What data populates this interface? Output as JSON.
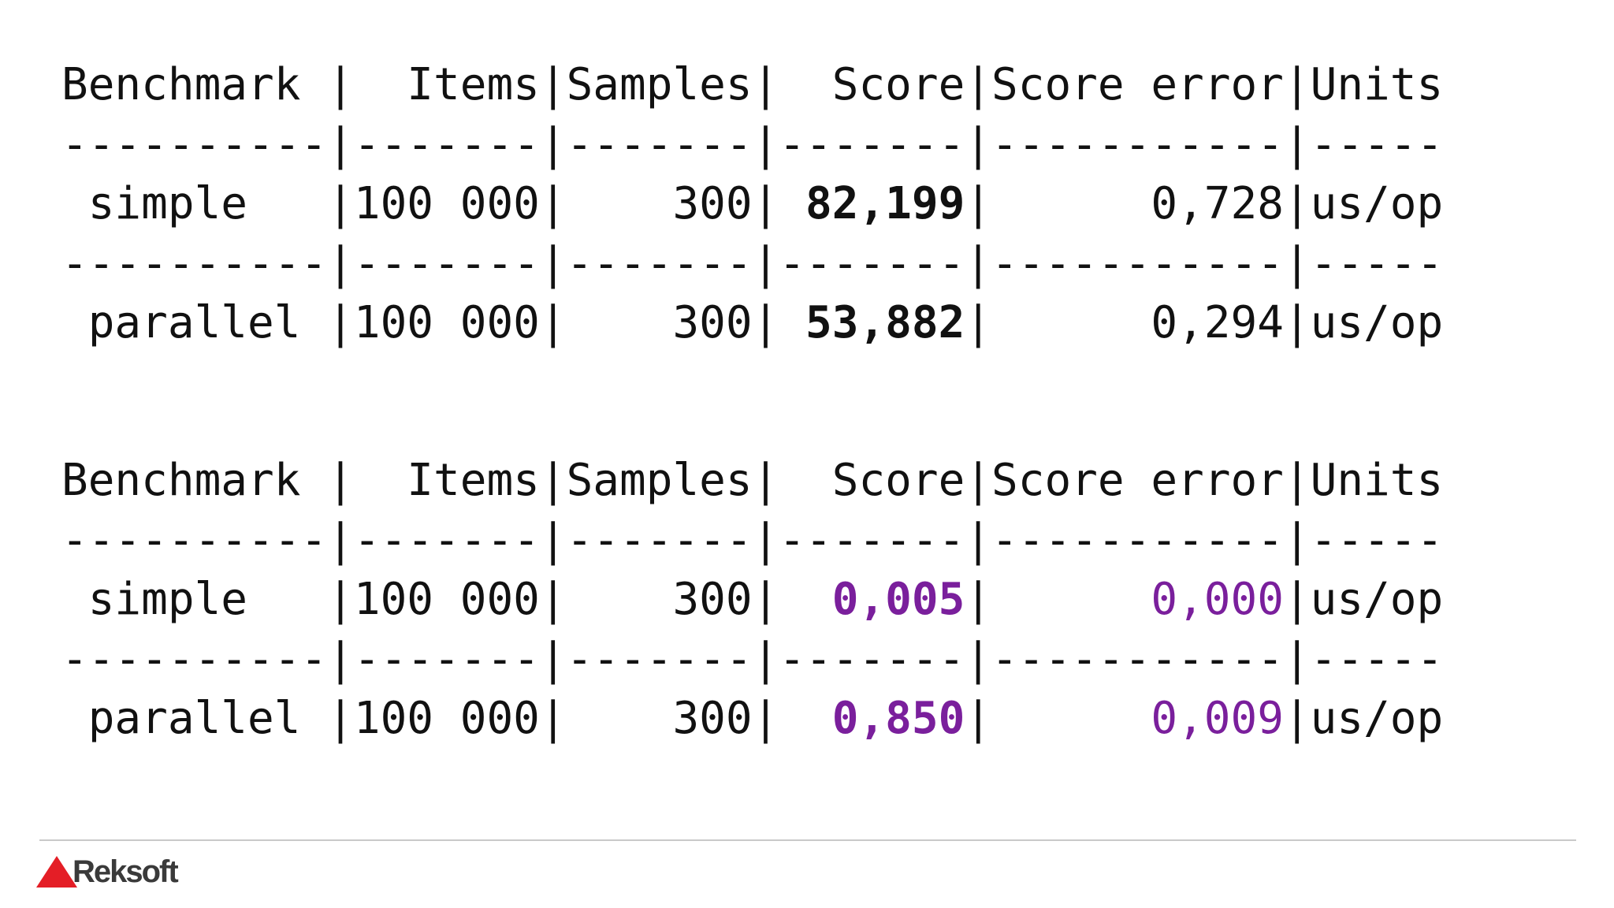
{
  "tables": [
    {
      "header": {
        "benchmark": "Benchmark |",
        "items": "  Items|",
        "samples": "Samples|",
        "score": "  Score|",
        "score_error": "Score error|",
        "units": "Units"
      },
      "separator": "----------|-------|-------|-------|-----------|-----",
      "rows": [
        {
          "benchmark": " simple   |",
          "items": "100 000|",
          "samples": "    300|",
          "score": " 82,199",
          "score_sep": "|",
          "score_error": "      0,728",
          "error_sep": "|",
          "units": "us/op"
        },
        {
          "benchmark": " parallel |",
          "items": "100 000|",
          "samples": "    300|",
          "score": " 53,882",
          "score_sep": "|",
          "score_error": "      0,294",
          "error_sep": "|",
          "units": "us/op"
        }
      ],
      "score_color": "#111111",
      "error_color": "#111111"
    },
    {
      "header": {
        "benchmark": "Benchmark |",
        "items": "  Items|",
        "samples": "Samples|",
        "score": "  Score|",
        "score_error": "Score error|",
        "units": "Units"
      },
      "separator": "----------|-------|-------|-------|-----------|-----",
      "rows": [
        {
          "benchmark": " simple   |",
          "items": "100 000|",
          "samples": "    300|",
          "score": "  0,005",
          "score_sep": "|",
          "score_error": "      0,000",
          "error_sep": "|",
          "units": "us/op"
        },
        {
          "benchmark": " parallel |",
          "items": "100 000|",
          "samples": "    300|",
          "score": "  0,850",
          "score_sep": "|",
          "score_error": "      0,009",
          "error_sep": "|",
          "units": "us/op"
        }
      ],
      "score_color": "#7a1f9c",
      "error_color": "#7a1f9c"
    }
  ],
  "footer": {
    "brand": "Reksoft",
    "brand_color": "#e41e26",
    "rule_color": "#c9c9c9"
  }
}
